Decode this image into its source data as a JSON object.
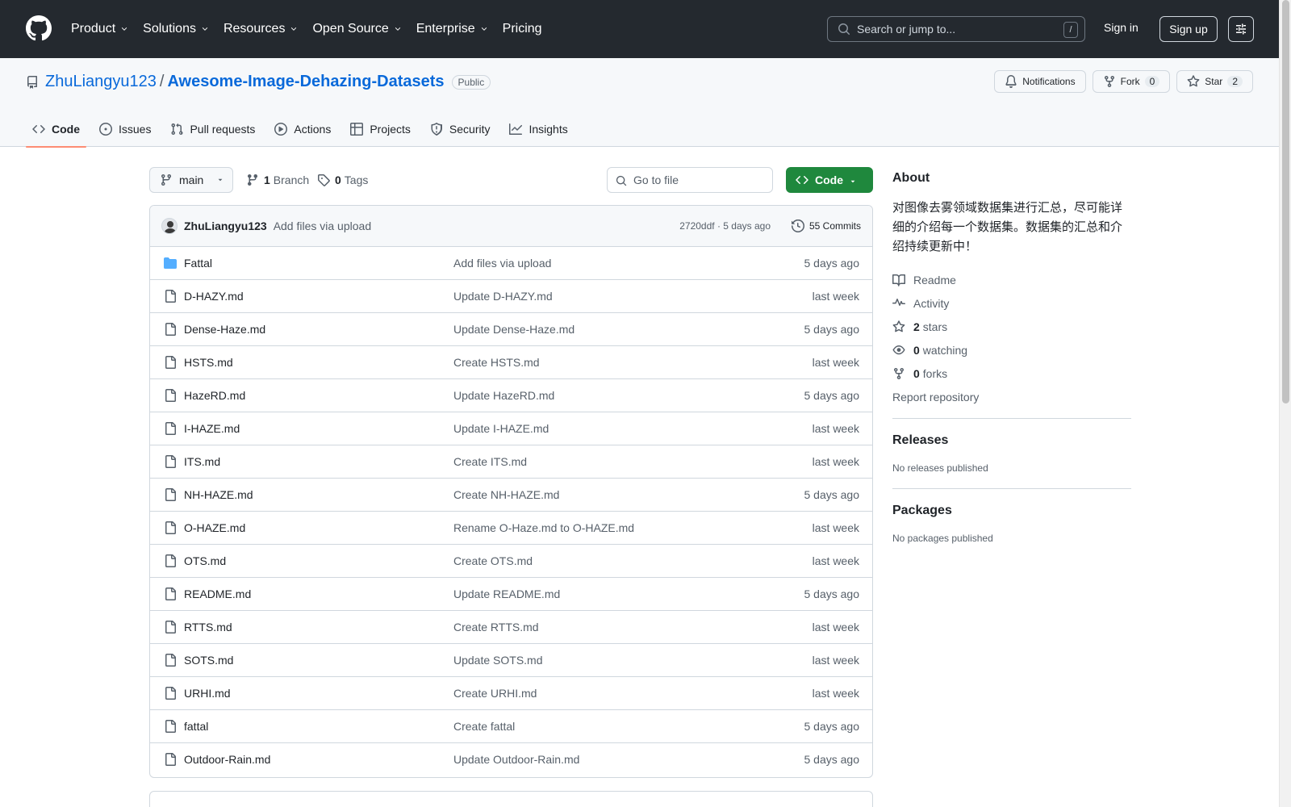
{
  "header": {
    "nav": [
      {
        "label": "Product",
        "has_menu": true
      },
      {
        "label": "Solutions",
        "has_menu": true
      },
      {
        "label": "Resources",
        "has_menu": true
      },
      {
        "label": "Open Source",
        "has_menu": true
      },
      {
        "label": "Enterprise",
        "has_menu": true
      },
      {
        "label": "Pricing",
        "has_menu": false
      }
    ],
    "search_placeholder": "Search or jump to...",
    "search_shortcut": "/",
    "sign_in": "Sign in",
    "sign_up": "Sign up"
  },
  "repo": {
    "owner": "ZhuLiangyu123",
    "separator": "/",
    "name": "Awesome-Image-Dehazing-Datasets",
    "visibility": "Public",
    "notifications_label": "Notifications",
    "fork_label": "Fork",
    "fork_count": "0",
    "star_label": "Star",
    "star_count": "2",
    "tabs": [
      {
        "label": "Code",
        "icon": "code-icon",
        "active": true
      },
      {
        "label": "Issues",
        "icon": "issue-icon",
        "active": false
      },
      {
        "label": "Pull requests",
        "icon": "pull-request-icon",
        "active": false
      },
      {
        "label": "Actions",
        "icon": "play-icon",
        "active": false
      },
      {
        "label": "Projects",
        "icon": "table-icon",
        "active": false
      },
      {
        "label": "Security",
        "icon": "shield-icon",
        "active": false
      },
      {
        "label": "Insights",
        "icon": "graph-icon",
        "active": false
      }
    ]
  },
  "toolbar": {
    "branch": "main",
    "branch_count": "1",
    "branch_label": "Branch",
    "tag_count": "0",
    "tag_label": "Tags",
    "goto_placeholder": "Go to file",
    "code_label": "Code"
  },
  "latest_commit": {
    "author": "ZhuLiangyu123",
    "message": "Add files via upload",
    "meta": "2720ddf · 5 days ago",
    "commits": "55 Commits"
  },
  "files": [
    {
      "name": "Fattal",
      "type": "dir",
      "commit": "Add files via upload",
      "date": "5 days ago"
    },
    {
      "name": "D-HAZY.md",
      "type": "file",
      "commit": "Update D-HAZY.md",
      "date": "last week"
    },
    {
      "name": "Dense-Haze.md",
      "type": "file",
      "commit": "Update Dense-Haze.md",
      "date": "5 days ago"
    },
    {
      "name": "HSTS.md",
      "type": "file",
      "commit": "Create HSTS.md",
      "date": "last week"
    },
    {
      "name": "HazeRD.md",
      "type": "file",
      "commit": "Update HazeRD.md",
      "date": "5 days ago"
    },
    {
      "name": "I-HAZE.md",
      "type": "file",
      "commit": "Update I-HAZE.md",
      "date": "last week"
    },
    {
      "name": "ITS.md",
      "type": "file",
      "commit": "Create ITS.md",
      "date": "last week"
    },
    {
      "name": "NH-HAZE.md",
      "type": "file",
      "commit": "Create NH-HAZE.md",
      "date": "5 days ago"
    },
    {
      "name": "O-HAZE.md",
      "type": "file",
      "commit": "Rename O-Haze.md to O-HAZE.md",
      "date": "last week"
    },
    {
      "name": "OTS.md",
      "type": "file",
      "commit": "Create OTS.md",
      "date": "last week"
    },
    {
      "name": "README.md",
      "type": "file",
      "commit": "Update README.md",
      "date": "5 days ago"
    },
    {
      "name": "RTTS.md",
      "type": "file",
      "commit": "Create RTTS.md",
      "date": "last week"
    },
    {
      "name": "SOTS.md",
      "type": "file",
      "commit": "Update SOTS.md",
      "date": "last week"
    },
    {
      "name": "URHI.md",
      "type": "file",
      "commit": "Create URHI.md",
      "date": "last week"
    },
    {
      "name": "fattal",
      "type": "file",
      "commit": "Create fattal",
      "date": "5 days ago"
    },
    {
      "name": "Outdoor-Rain.md",
      "type": "file",
      "commit": "Update Outdoor-Rain.md",
      "date": "5 days ago"
    }
  ],
  "about": {
    "title": "About",
    "description": "对图像去雾领域数据集进行汇总，尽可能详细的介绍每一个数据集。数据集的汇总和介绍持续更新中！",
    "readme": "Readme",
    "activity": "Activity",
    "stars_count": "2",
    "stars_label": "stars",
    "watching_count": "0",
    "watching_label": "watching",
    "forks_count": "0",
    "forks_label": "forks",
    "report": "Report repository"
  },
  "releases": {
    "title": "Releases",
    "empty": "No releases published"
  },
  "packages": {
    "title": "Packages",
    "empty": "No packages published"
  },
  "colors": {
    "accent": "#0969da",
    "header_bg": "#24292f",
    "code_button": "#1f883d",
    "tab_underline": "#fd8c73",
    "folder": "#54aeff"
  }
}
